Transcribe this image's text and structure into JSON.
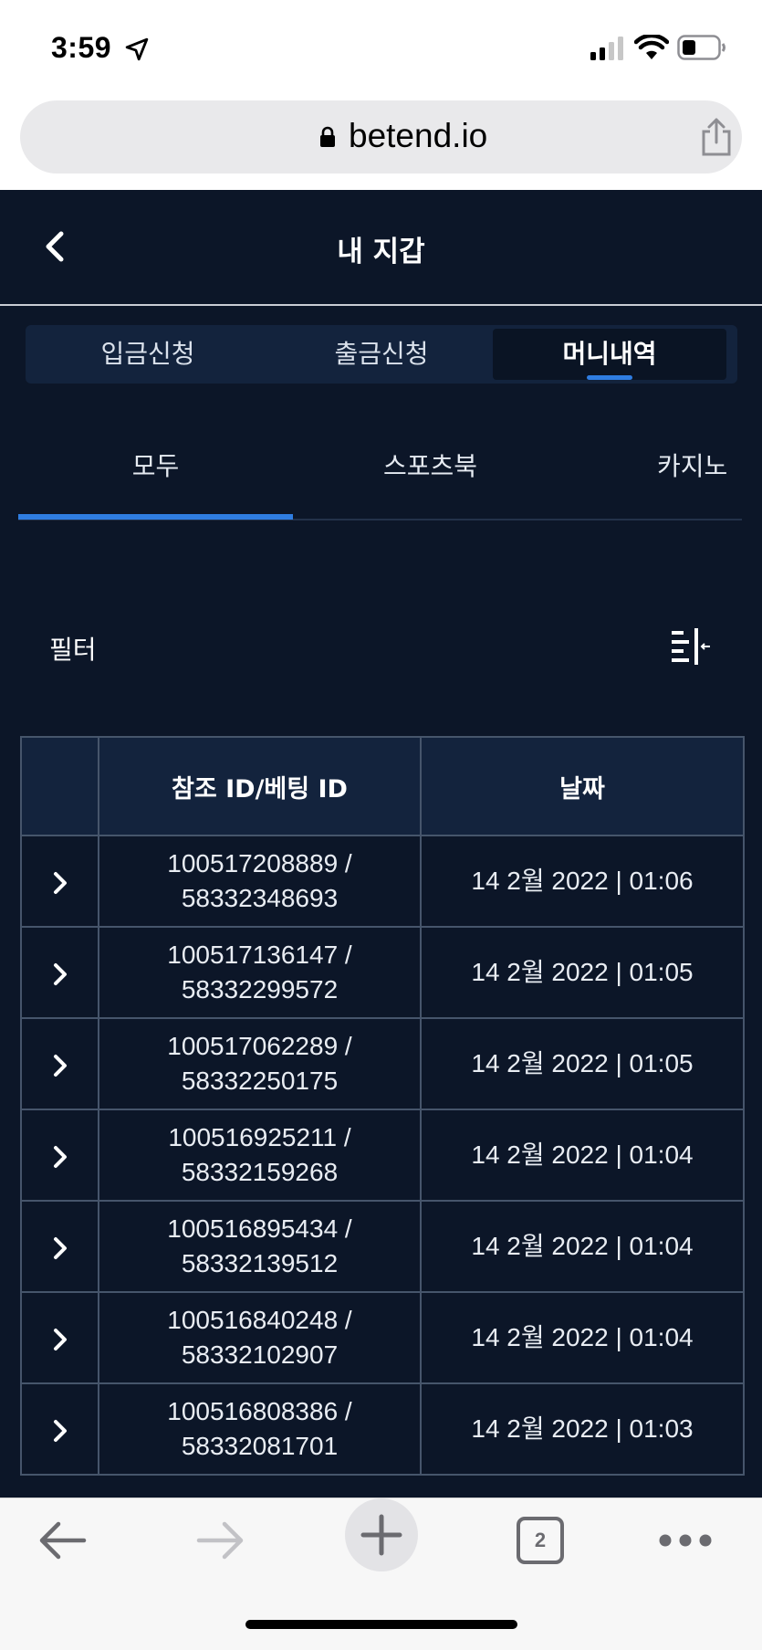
{
  "status_bar": {
    "time": "3:59"
  },
  "browser": {
    "url": "betend.io",
    "open_tabs": "2"
  },
  "app": {
    "title": "내 지갑",
    "main_tabs": [
      {
        "label": "입금신청",
        "active": false
      },
      {
        "label": "출금신청",
        "active": false
      },
      {
        "label": "머니내역",
        "active": true
      }
    ],
    "sub_tabs": [
      {
        "label": "모두",
        "active": true
      },
      {
        "label": "스포츠북",
        "active": false
      },
      {
        "label": "카지노",
        "active": false
      }
    ],
    "filter_label": "필터",
    "table": {
      "headers": [
        "",
        "참조 ID/베팅 ID",
        "날짜"
      ],
      "rows": [
        {
          "ref_id": "100517208889 /",
          "bet_id": "58332348693",
          "date": "14 2월 2022 | 01:06"
        },
        {
          "ref_id": "100517136147 /",
          "bet_id": "58332299572",
          "date": "14 2월 2022 | 01:05"
        },
        {
          "ref_id": "100517062289 /",
          "bet_id": "58332250175",
          "date": "14 2월 2022 | 01:05"
        },
        {
          "ref_id": "100516925211 /",
          "bet_id": "58332159268",
          "date": "14 2월 2022 | 01:04"
        },
        {
          "ref_id": "100516895434 /",
          "bet_id": "58332139512",
          "date": "14 2월 2022 | 01:04"
        },
        {
          "ref_id": "100516840248 /",
          "bet_id": "58332102907",
          "date": "14 2월 2022 | 01:04"
        },
        {
          "ref_id": "100516808386 /",
          "bet_id": "58332081701",
          "date": "14 2월 2022 | 01:03"
        }
      ]
    }
  },
  "colors": {
    "background": "#0c1628",
    "panel": "#13233d",
    "accent": "#2f7de1",
    "border": "#46556b"
  }
}
